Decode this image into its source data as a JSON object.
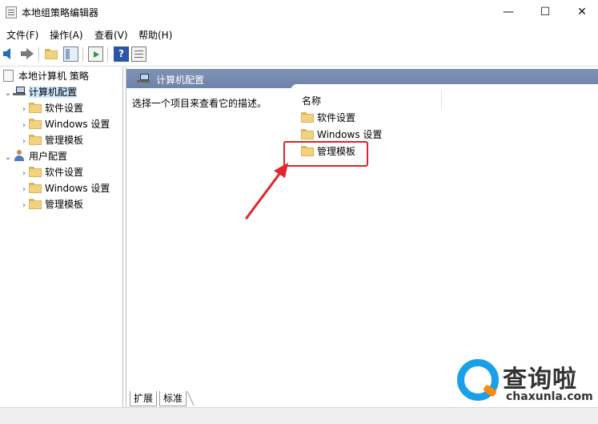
{
  "window": {
    "title": "本地组策略编辑器",
    "minimize": "—",
    "maximize": "☐",
    "close": "✕"
  },
  "menu": [
    {
      "label": "文件(F)"
    },
    {
      "label": "操作(A)"
    },
    {
      "label": "查看(V)"
    },
    {
      "label": "帮助(H)"
    }
  ],
  "toolbar": {
    "icons": [
      "back-arrow-icon",
      "forward-arrow-icon",
      "up-folder-icon",
      "show-hide-tree-icon",
      "export-list-icon",
      "help-icon",
      "properties-icon"
    ],
    "help_glyph": "?"
  },
  "tree": {
    "root": "本地计算机 策略",
    "computer_config": "计算机配置",
    "computer_children": [
      "软件设置",
      "Windows 设置",
      "管理模板"
    ],
    "user_config": "用户配置",
    "user_children": [
      "软件设置",
      "Windows 设置",
      "管理模板"
    ]
  },
  "detail": {
    "header": "计算机配置",
    "description": "选择一个项目来查看它的描述。",
    "column_name": "名称",
    "items": [
      "软件设置",
      "Windows 设置",
      "管理模板"
    ],
    "highlighted_item": "管理模板"
  },
  "tabs": [
    "扩展",
    "标准"
  ],
  "watermark": {
    "chinese": "查询啦",
    "english": "chaxunla.com"
  },
  "colors": {
    "header_bg": "#7289ae",
    "selected_bg": "#cce8ff",
    "highlight_red": "#d9262b",
    "folder_yellow": "#f3d27d"
  }
}
